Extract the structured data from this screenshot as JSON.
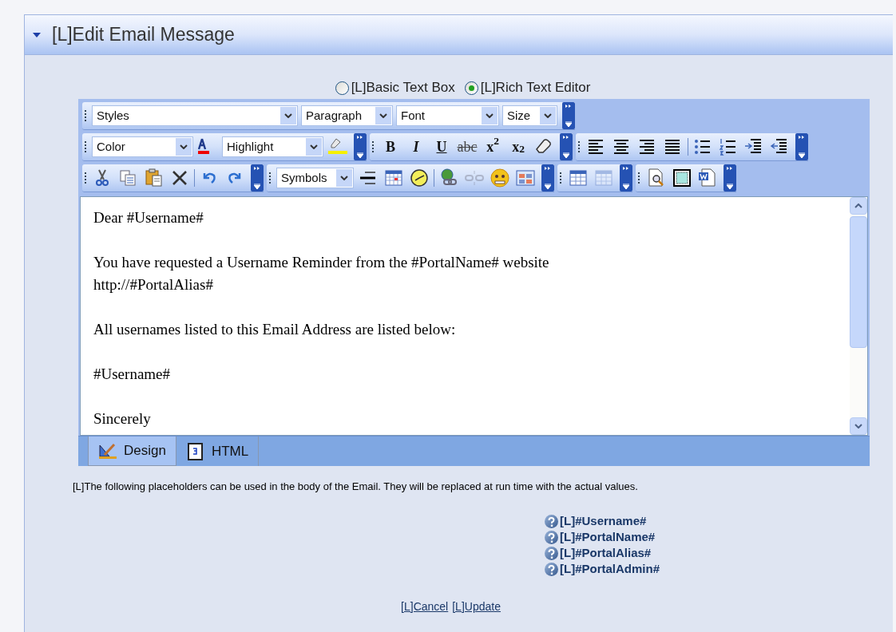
{
  "panel": {
    "title": "[L]Edit Email Message",
    "expanded": true
  },
  "editor_mode": [
    {
      "label": "[L]Basic Text Box",
      "selected": false
    },
    {
      "label": "[L]Rich Text Editor",
      "selected": true
    }
  ],
  "toolbar_rows": [
    [
      [
        {
          "kind": "dropdown",
          "label": "Styles"
        },
        {
          "kind": "dropdown",
          "label": "Paragraph"
        },
        {
          "kind": "dropdown",
          "label": "Font"
        },
        {
          "kind": "dropdown",
          "label": "Size"
        }
      ]
    ],
    [
      [
        {
          "kind": "dropdown",
          "label": "Color"
        },
        {
          "kind": "fontcolor"
        },
        {
          "kind": "dropdown",
          "label": "Highlight"
        },
        {
          "kind": "highlight"
        }
      ],
      [
        {
          "kind": "bold",
          "label": "B"
        },
        {
          "kind": "italic",
          "label": "I"
        },
        {
          "kind": "underline",
          "label": "U"
        },
        {
          "kind": "strike",
          "label": "abc"
        },
        {
          "kind": "superscript",
          "label": "x$^{2}$"
        },
        {
          "kind": "subscript",
          "label": "x$_{2}$"
        },
        {
          "kind": "eraser"
        }
      ],
      [
        {
          "kind": "alignleft"
        },
        {
          "kind": "aligncenter"
        },
        {
          "kind": "alignright"
        },
        {
          "kind": "justify"
        },
        {
          "kind": "sep"
        },
        {
          "kind": "bullets"
        },
        {
          "kind": "numbers"
        },
        {
          "kind": "outdent"
        },
        {
          "kind": "indent"
        }
      ]
    ],
    [
      [
        {
          "kind": "cut"
        },
        {
          "kind": "copy"
        },
        {
          "kind": "paste"
        },
        {
          "kind": "delete"
        },
        {
          "kind": "sep"
        },
        {
          "kind": "undo"
        },
        {
          "kind": "redo"
        }
      ],
      [
        {
          "kind": "dropdown",
          "label": "Symbols"
        },
        {
          "kind": "rule"
        },
        {
          "kind": "calendar"
        },
        {
          "kind": "clock"
        },
        {
          "kind": "sep"
        },
        {
          "kind": "link"
        },
        {
          "kind": "unlink",
          "disabled": true
        },
        {
          "kind": "smiley"
        },
        {
          "kind": "grid"
        }
      ],
      [
        {
          "kind": "table"
        },
        {
          "kind": "table",
          "disabled": true
        }
      ],
      [
        {
          "kind": "preview"
        },
        {
          "kind": "selectall"
        },
        {
          "kind": "word"
        }
      ]
    ]
  ],
  "body_paragraphs": [
    [
      "Dear #Username#"
    ],
    [
      "You have requested a Username Reminder from the #PortalName# website",
      "http://#PortalAlias#"
    ],
    [
      "All usernames listed to this Email Address are listed below:"
    ],
    [
      "#Username#"
    ],
    [
      "Sincerely"
    ]
  ],
  "view_tabs": [
    {
      "label": "Design",
      "selected": true,
      "kind": "design"
    },
    {
      "label": "HTML",
      "selected": false,
      "kind": "html"
    }
  ],
  "note": "[L]The following placeholders can be used in the body of the Email. They will be replaced at run time with the actual values.",
  "placeholders": [
    "[L]#Username#",
    "[L]#PortalName#",
    "[L]#PortalAlias#",
    "[L]#PortalAdmin#"
  ],
  "actions": [
    "[L]Cancel",
    "[L]Update"
  ]
}
